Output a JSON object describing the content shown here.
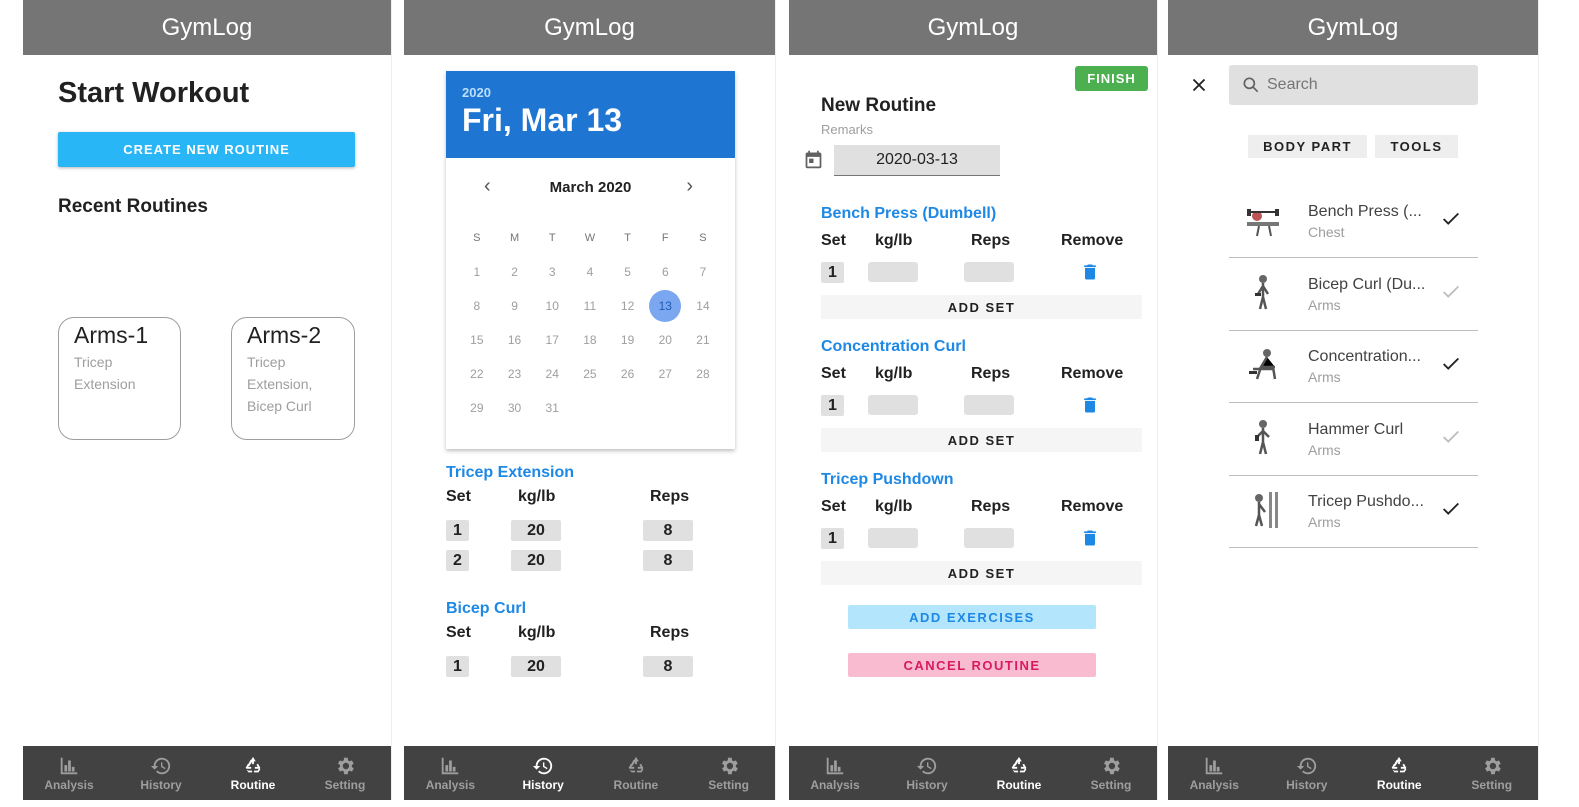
{
  "app_title": "GymLog",
  "nav": {
    "analysis": "Analysis",
    "history": "History",
    "routine": "Routine",
    "setting": "Setting"
  },
  "s1": {
    "title": "Start Workout",
    "create_button": "CREATE NEW ROUTINE",
    "recent_heading": "Recent Routines",
    "cards": [
      {
        "name": "Arms-1",
        "desc": "Tricep Extension"
      },
      {
        "name": "Arms-2",
        "desc": "Tricep Extension, Bicep Curl"
      }
    ]
  },
  "s2": {
    "year": "2020",
    "selected_date": "Fri, Mar 13",
    "month_label": "March 2020",
    "days_of_week": [
      "S",
      "M",
      "T",
      "W",
      "T",
      "F",
      "S"
    ],
    "selected_day": "13",
    "headers": {
      "set": "Set",
      "weight": "kg/lb",
      "reps": "Reps"
    },
    "exercises": [
      {
        "name": "Tricep Extension",
        "sets": [
          {
            "set": "1",
            "weight": "20",
            "reps": "8"
          },
          {
            "set": "2",
            "weight": "20",
            "reps": "8"
          }
        ]
      },
      {
        "name": "Bicep Curl",
        "sets": [
          {
            "set": "1",
            "weight": "20",
            "reps": "8"
          }
        ]
      }
    ]
  },
  "s3": {
    "finish_button": "FINISH",
    "routine_name": "New Routine",
    "remarks_label": "Remarks",
    "date_value": "2020-03-13",
    "headers": {
      "set": "Set",
      "weight": "kg/lb",
      "reps": "Reps",
      "remove": "Remove"
    },
    "add_set_label": "ADD SET",
    "exercises": [
      {
        "name": "Bench Press (Dumbell)",
        "set": "1"
      },
      {
        "name": "Concentration Curl",
        "set": "1"
      },
      {
        "name": "Tricep Pushdown",
        "set": "1"
      }
    ],
    "add_exercises_button": "ADD EXERCISES",
    "cancel_button": "CANCEL ROUTINE",
    "colors": {
      "finish": "#4caf50",
      "exercise_title": "#1e88e5",
      "trash": "#1e88e5"
    }
  },
  "s4": {
    "search_placeholder": "Search",
    "filters": [
      "BODY PART",
      "TOOLS"
    ],
    "exercises": [
      {
        "name": "Bench Press (...",
        "category": "Chest",
        "checked": true
      },
      {
        "name": "Bicep Curl (Du...",
        "category": "Arms",
        "checked": false
      },
      {
        "name": "Concentration...",
        "category": "Arms",
        "checked": true
      },
      {
        "name": "Hammer Curl",
        "category": "Arms",
        "checked": false
      },
      {
        "name": "Tricep Pushdo...",
        "category": "Arms",
        "checked": true
      }
    ]
  }
}
